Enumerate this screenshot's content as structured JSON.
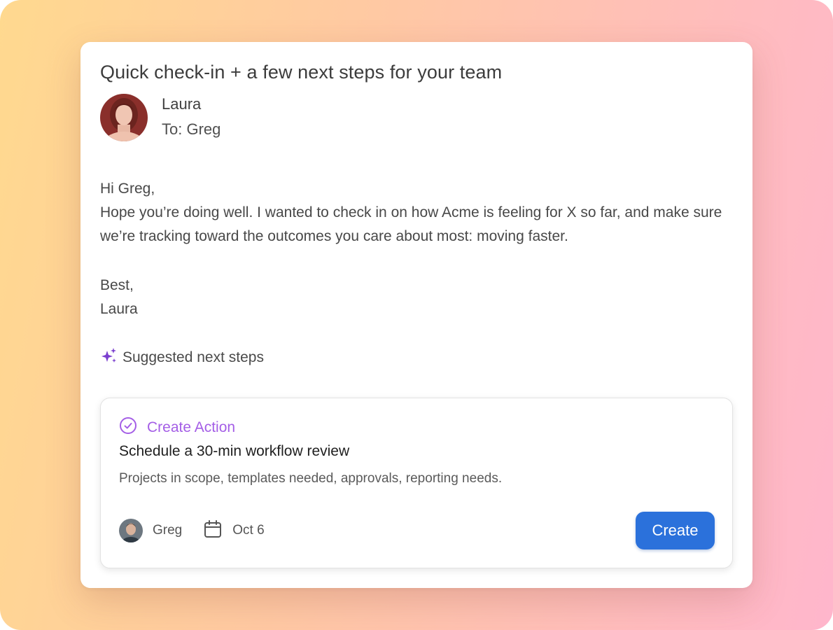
{
  "email": {
    "subject": "Quick check-in + a few next steps for your team",
    "sender_name": "Laura",
    "recipient_line": "To: Greg",
    "greeting": "Hi Greg,",
    "paragraph": "Hope you’re doing well. I wanted to check in on how Acme is feeling for X so far, and make sure we’re tracking toward the outcomes you care about most: moving faster.",
    "signoff": "Best,",
    "signature": "Laura"
  },
  "suggestions": {
    "heading": "Suggested next steps",
    "icon": "sparkle-icon",
    "accent_color": "#7b3fcf"
  },
  "action_card": {
    "type_label": "Create Action",
    "type_icon": "check-circle-icon",
    "type_color": "#a45ee6",
    "title": "Schedule a 30-min workflow review",
    "description": "Projects in scope, templates needed, approvals, reporting needs.",
    "assignee": "Greg",
    "due_date": "Oct 6",
    "date_icon": "calendar-icon",
    "button_label": "Create",
    "button_color": "#2b71db"
  }
}
